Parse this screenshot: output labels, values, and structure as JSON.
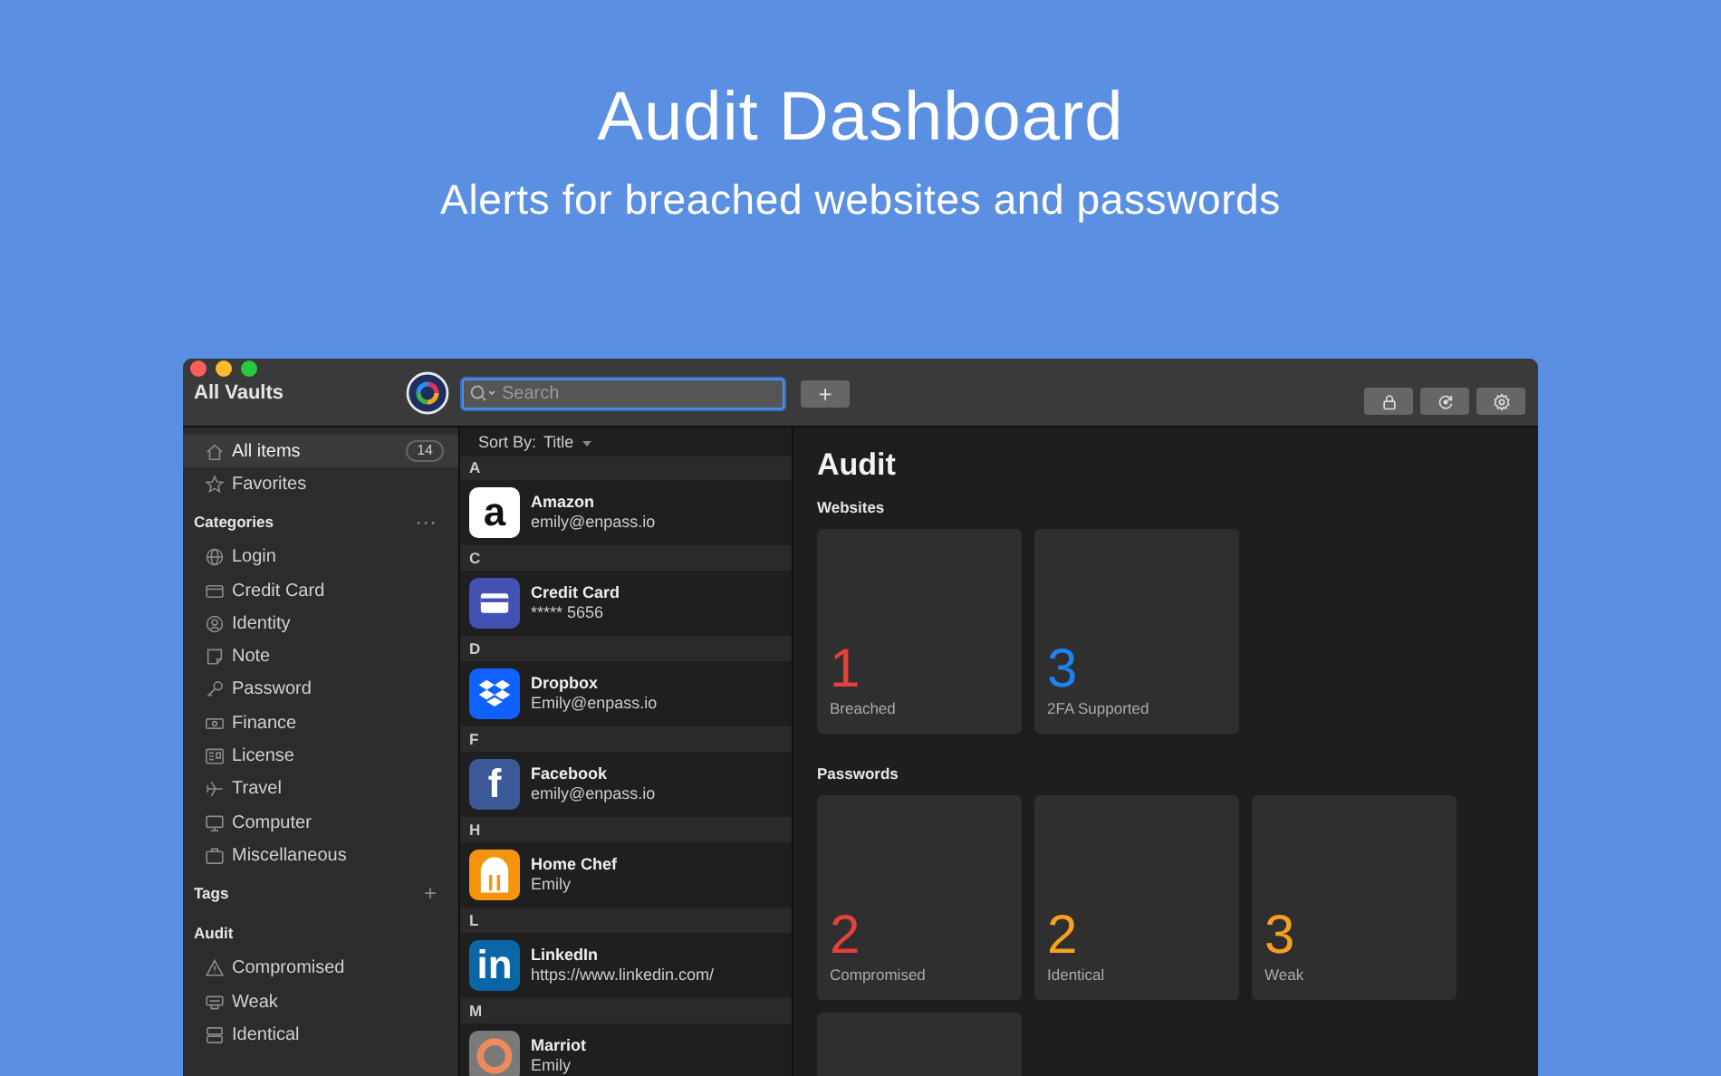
{
  "hero": {
    "title": "Audit Dashboard",
    "subtitle": "Alerts for breached websites and passwords"
  },
  "window": {
    "title": "All Vaults"
  },
  "search": {
    "placeholder": "Search"
  },
  "add_button": "+",
  "sidebar": {
    "top_items": [
      {
        "label": "All items",
        "count": "14",
        "selected": true
      },
      {
        "label": "Favorites",
        "selected": false
      }
    ],
    "sections": [
      {
        "title": "Categories",
        "action": "···",
        "items": [
          {
            "label": "Login",
            "selected": false
          },
          {
            "label": "Credit Card",
            "selected": false
          },
          {
            "label": "Identity",
            "selected": false
          },
          {
            "label": "Note",
            "selected": false
          },
          {
            "label": "Password",
            "selected": false
          },
          {
            "label": "Finance",
            "selected": false
          },
          {
            "label": "License",
            "selected": false
          },
          {
            "label": "Travel",
            "selected": false
          },
          {
            "label": "Computer",
            "selected": false
          },
          {
            "label": "Miscellaneous",
            "selected": false
          }
        ]
      },
      {
        "title": "Tags",
        "action": "+"
      },
      {
        "title": "Audit",
        "items": [
          {
            "label": "Compromised",
            "selected": false
          },
          {
            "label": "Weak",
            "selected": false
          },
          {
            "label": "Identical",
            "selected": false
          }
        ]
      }
    ]
  },
  "list": {
    "sort_label": "Sort By:",
    "sort_value": "Title",
    "groups": [
      {
        "letter": "A",
        "items": [
          {
            "title": "Amazon",
            "subtitle": "emily@enpass.io",
            "logo": "a",
            "color": "#ffffff"
          }
        ]
      },
      {
        "letter": "C",
        "items": [
          {
            "title": "Credit Card",
            "subtitle": "***** 5656",
            "color": "#4350b4"
          }
        ]
      },
      {
        "letter": "D",
        "items": [
          {
            "title": "Dropbox",
            "subtitle": "Emily@enpass.io",
            "color": "#0f62fe"
          }
        ]
      },
      {
        "letter": "F",
        "items": [
          {
            "title": "Facebook",
            "subtitle": "emily@enpass.io",
            "logo": "f",
            "color": "#3b5998"
          }
        ]
      },
      {
        "letter": "H",
        "items": [
          {
            "title": "Home Chef",
            "subtitle": "Emily",
            "color": "#f5940f"
          }
        ]
      },
      {
        "letter": "L",
        "items": [
          {
            "title": "LinkedIn",
            "subtitle": "https://www.linkedin.com/",
            "logo": "in",
            "color": "#0a66a6"
          }
        ]
      },
      {
        "letter": "M",
        "items": [
          {
            "title": "Marriot",
            "subtitle": "Emily",
            "color": "#7a7a7a"
          }
        ]
      }
    ]
  },
  "audit": {
    "title": "Audit",
    "sections": [
      {
        "title": "Websites",
        "cards": [
          {
            "value": "1",
            "label": "Breached",
            "color": "#e5403c"
          },
          {
            "value": "3",
            "label": "2FA Supported",
            "color": "#1b84f2"
          }
        ]
      },
      {
        "title": "Passwords",
        "more_below": true,
        "cards": [
          {
            "value": "2",
            "label": "Compromised",
            "color": "#e5403c"
          },
          {
            "value": "2",
            "label": "Identical",
            "color": "#f4a11f"
          },
          {
            "value": "3",
            "label": "Weak",
            "color": "#f4a11f"
          }
        ]
      }
    ]
  }
}
